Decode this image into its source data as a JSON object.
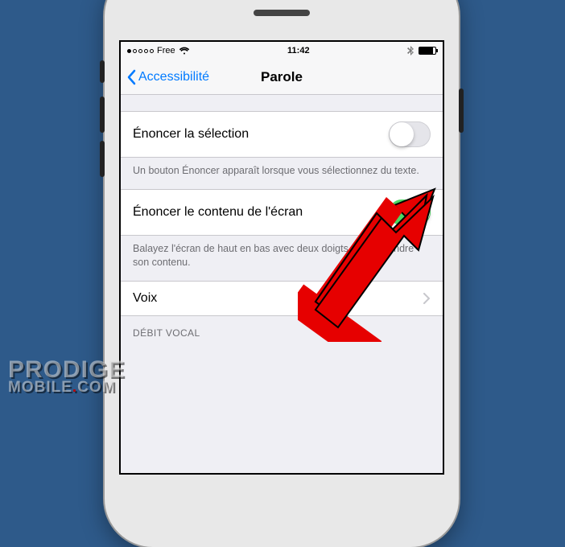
{
  "status": {
    "carrier": "Free",
    "time": "11:42"
  },
  "nav": {
    "back_label": "Accessibilité",
    "title": "Parole"
  },
  "rows": {
    "speak_selection": {
      "label": "Énoncer la sélection",
      "on": false,
      "footer": "Un bouton Énoncer apparaît lorsque vous sélectionnez du texte."
    },
    "speak_screen": {
      "label": "Énoncer le contenu de l'écran",
      "on": true,
      "footer": "Balayez l'écran de haut en bas avec deux doigts pour entendre son contenu."
    },
    "voices": {
      "label": "Voix"
    },
    "rate_header": "DÉBIT VOCAL"
  },
  "watermark": {
    "line1": "PRODIGE",
    "line2_a": "MOBILE",
    "line2_b": "COM"
  }
}
